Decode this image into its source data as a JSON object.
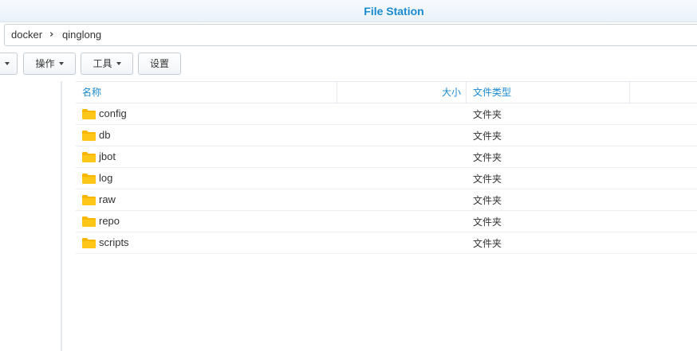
{
  "window": {
    "title": "File Station"
  },
  "breadcrumb": [
    "docker",
    "qinglong"
  ],
  "toolbar": {
    "ops_label": "操作",
    "tools_label": "工具",
    "settings_label": "设置"
  },
  "columns": {
    "name": "名称",
    "size": "大小",
    "type": "文件类型"
  },
  "files": [
    {
      "name": "config",
      "type": "文件夹"
    },
    {
      "name": "db",
      "type": "文件夹"
    },
    {
      "name": "jbot",
      "type": "文件夹"
    },
    {
      "name": "log",
      "type": "文件夹"
    },
    {
      "name": "raw",
      "type": "文件夹"
    },
    {
      "name": "repo",
      "type": "文件夹"
    },
    {
      "name": "scripts",
      "type": "文件夹"
    }
  ],
  "icons": {
    "folder": "folder-icon",
    "separator": "chevron-right-icon",
    "dropdown": "caret-down-icon"
  },
  "colors": {
    "accent": "#1a8bd2",
    "folder": "#f8b600"
  }
}
